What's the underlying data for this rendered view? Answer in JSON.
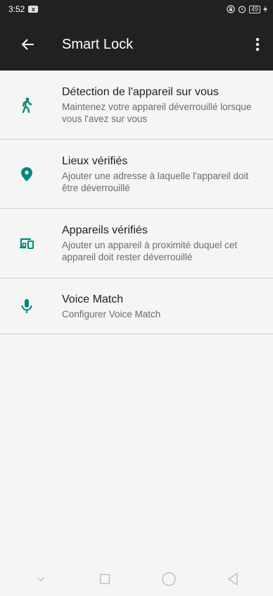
{
  "status_bar": {
    "time": "3:52",
    "battery": "49",
    "notification_badge": "x"
  },
  "app_bar": {
    "title": "Smart Lock",
    "back_icon": "arrow-left-icon",
    "menu_icon": "more-vert-icon"
  },
  "colors": {
    "app_bar": "#212121",
    "accent": "#00897b",
    "background": "#f5f5f5",
    "title_text": "#212121",
    "subtitle_text": "#6b6b6b"
  },
  "items": [
    {
      "icon": "walking-person-icon",
      "title": "Détection de l'appareil sur vous",
      "subtitle": "Maintenez votre appareil déverrouillé lorsque vous l'avez sur vous"
    },
    {
      "icon": "location-pin-icon",
      "title": "Lieux vérifiés",
      "subtitle": "Ajouter une adresse à laquelle l'appareil doit être déverrouillé"
    },
    {
      "icon": "devices-icon",
      "title": "Appareils vérifiés",
      "subtitle": "Ajouter un appareil à proximité duquel cet appareil doit rester déverrouillé"
    },
    {
      "icon": "microphone-icon",
      "title": "Voice Match",
      "subtitle": "Configurer Voice Match"
    }
  ],
  "nav_bar": {
    "buttons": [
      "chevron-down-icon",
      "square-recent-icon",
      "circle-home-icon",
      "triangle-back-icon"
    ]
  }
}
